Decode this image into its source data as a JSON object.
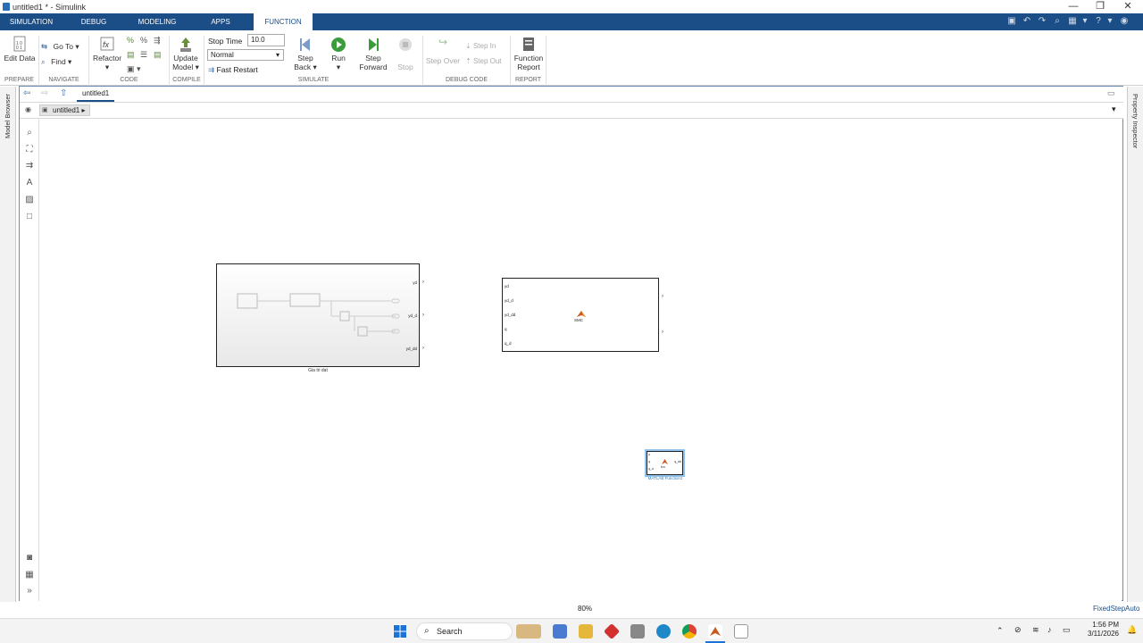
{
  "window": {
    "title": "untitled1 * - Simulink",
    "minimize": "—",
    "restore": "❐",
    "close": "✕"
  },
  "tabs": [
    "SIMULATION",
    "DEBUG",
    "MODELING",
    "APPS",
    "FUNCTION"
  ],
  "ribbon": {
    "edit_data": "Edit Data",
    "go_to": "Go To",
    "find": "Find",
    "refactor": "Refactor",
    "update_model": [
      "Update",
      "Model"
    ],
    "stop_time_label": "Stop Time",
    "stop_time_value": "10.0",
    "mode_value": "Normal",
    "fast_restart": "Fast Restart",
    "step_back": [
      "Step",
      "Back"
    ],
    "run": "Run",
    "step_forward": [
      "Step",
      "Forward"
    ],
    "stop": "Stop",
    "step_over": "Step Over",
    "step_in": "Step In",
    "step_out": "Step Out",
    "function_report": [
      "Function",
      "Report"
    ],
    "groups": [
      "PREPARE",
      "NAVIGATE",
      "CODE",
      "COMPILE",
      "SIMULATE",
      "DEBUG CODE",
      "REPORT"
    ]
  },
  "editor": {
    "tab": "untitled1",
    "breadcrumb": "untitled1"
  },
  "side": {
    "left": "Model Browser",
    "right": "Property Inspector"
  },
  "blocks": {
    "subsystem": {
      "label": "Gia tri dat",
      "outputs": [
        "yd",
        "yd_d",
        "yd_dd"
      ]
    },
    "smc": {
      "name": "SMC",
      "inputs": [
        "yd",
        "yd_d",
        "yd_dd",
        "q",
        "q_d"
      ]
    },
    "matlab_fn": {
      "label": "MATLAB Function1",
      "inputs": [
        "u",
        "q",
        "q_d"
      ],
      "center": "fcn",
      "output": "q_dd"
    }
  },
  "status": {
    "zoom": "80%",
    "solver": "FixedStepAuto"
  },
  "taskbar": {
    "search": "Search",
    "time": "1:56 PM",
    "date": "3/11/2026"
  }
}
